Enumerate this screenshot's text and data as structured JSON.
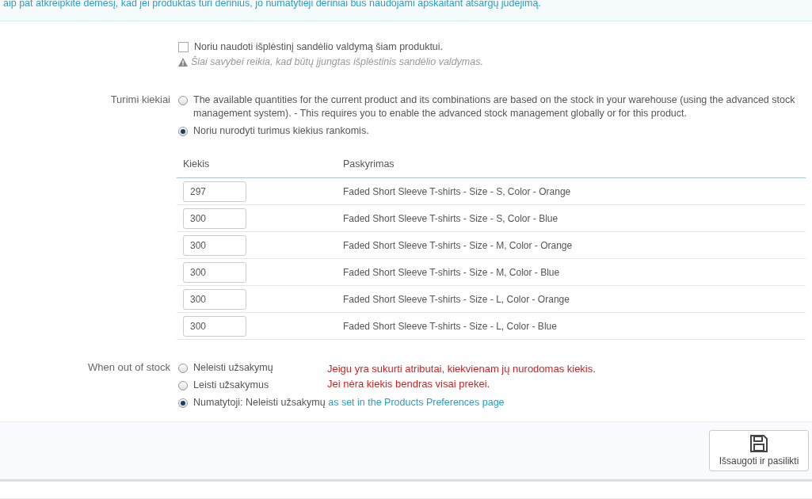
{
  "notice": {
    "text": "aip pat atkreipkite dėmesį, kad jei produktas turi derinius, jo numatytieji deriniai bus naudojami apskaitant atsargų judėjimą."
  },
  "advanced_stock": {
    "label": "Noriu naudoti išplėstinį sandėlio valdymą šiam produktui.",
    "checked": false,
    "warning": "Šiai savybei reikia, kad būtų įjungtas išplėstinis sandėlio valdymas."
  },
  "available_quantities": {
    "label": "Turimi kiekiai",
    "options": [
      {
        "text": "The available quantities for the current product and its combinations are based on the stock in your warehouse (using the advanced stock management system).  - This requires you to enable the advanced stock management globally or for this product.",
        "selected": false
      },
      {
        "text": "Noriu nurodyti turimus kiekius rankomis.",
        "selected": true
      }
    ]
  },
  "table": {
    "columns": [
      "Kiekis",
      "Paskyrimas"
    ],
    "rows": [
      {
        "quantity": "297",
        "designation": "Faded Short Sleeve T-shirts - Size - S, Color - Orange"
      },
      {
        "quantity": "300",
        "designation": "Faded Short Sleeve T-shirts - Size - S, Color - Blue"
      },
      {
        "quantity": "300",
        "designation": "Faded Short Sleeve T-shirts - Size - M, Color - Orange"
      },
      {
        "quantity": "300",
        "designation": "Faded Short Sleeve T-shirts - Size - M, Color - Blue"
      },
      {
        "quantity": "300",
        "designation": "Faded Short Sleeve T-shirts - Size - L, Color - Orange"
      },
      {
        "quantity": "300",
        "designation": "Faded Short Sleeve T-shirts - Size - L, Color - Blue"
      }
    ]
  },
  "out_of_stock": {
    "label": "When out of stock",
    "options": [
      {
        "text": "Neleisti užsakymų",
        "selected": false
      },
      {
        "text": "Leisti užsakymus",
        "selected": false
      },
      {
        "text": "Numatytoji: Neleisti užsakymų",
        "link": "as set in the Products Preferences page",
        "selected": true
      }
    ]
  },
  "annotation": {
    "lines": [
      "Jeigu yra sukurti atributai, kiekvienam jų nurodomas kiekis.",
      "Jei nėra kiekis bendras visai prekei."
    ]
  },
  "footer": {
    "save_button": "Išsaugoti ir pasilikti"
  }
}
